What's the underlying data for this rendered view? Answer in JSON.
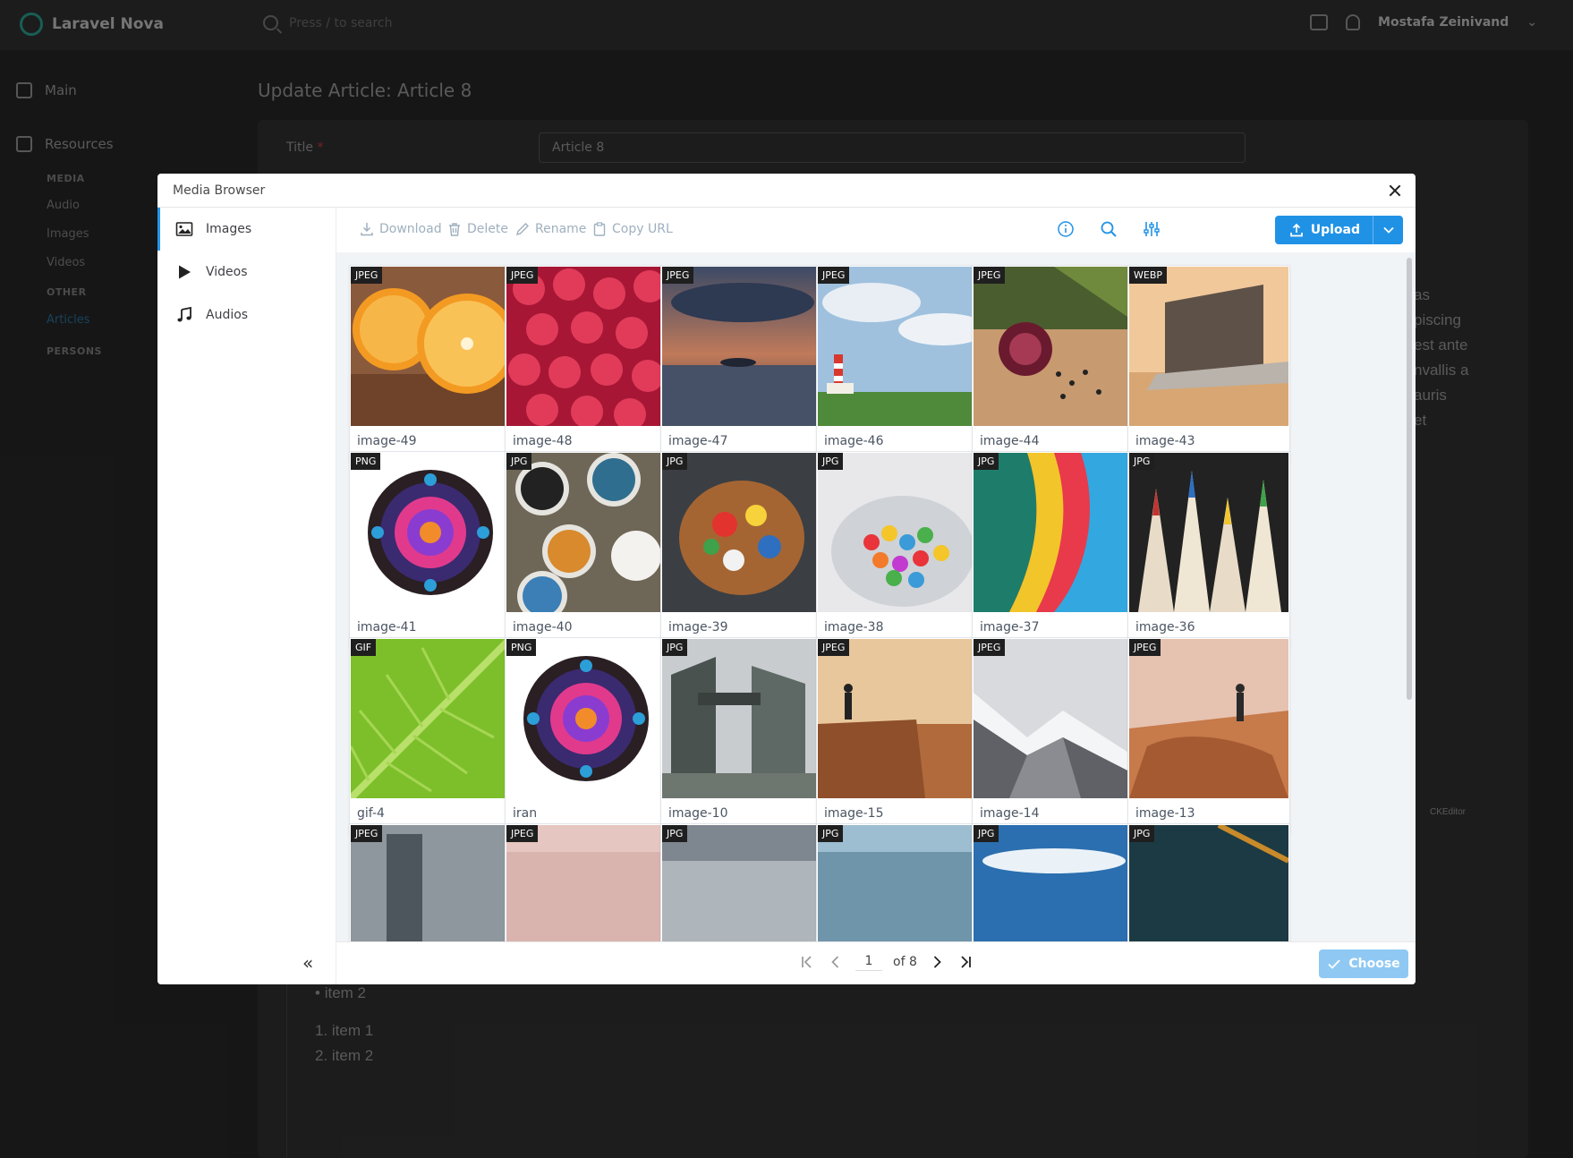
{
  "app": {
    "brand": "Laravel Nova",
    "search_placeholder": "Press / to search",
    "user_name": "Mostafa Zeinivand",
    "page_title": "Update Article: Article 8",
    "title_label": "Title",
    "title_required": "*",
    "title_value": "Article 8"
  },
  "sidebar": {
    "main": "Main",
    "resources": "Resources",
    "media_caption": "MEDIA",
    "audio": "Audio",
    "images": "Images",
    "videos": "Videos",
    "other_caption": "OTHER",
    "articles": "Articles",
    "persons_caption": "PERSONS"
  },
  "editor_bg": {
    "line1": "as",
    "line2": "piscing",
    "line3": "est ante",
    "line4": "nvallis a",
    "line5": "auris",
    "line6": "et",
    "bullet": "item 2",
    "ol1": "1. item 1",
    "ol2": "2. item 2",
    "ckeditor": "CKEditor"
  },
  "modal": {
    "title": "Media Browser",
    "nav": [
      "Images",
      "Videos",
      "Audios"
    ],
    "toolbar": {
      "download": "Download",
      "delete": "Delete",
      "rename": "Rename",
      "copy_url": "Copy URL",
      "upload": "Upload"
    },
    "pager": {
      "page": "1",
      "of": "of 8"
    },
    "choose": "Choose",
    "colors": {
      "accent": "#2092e6",
      "choose_disabled": "#8fc9f3"
    }
  },
  "media": [
    {
      "badge": "JPEG",
      "name": "image-49"
    },
    {
      "badge": "JPEG",
      "name": "image-48"
    },
    {
      "badge": "JPEG",
      "name": "image-47"
    },
    {
      "badge": "JPEG",
      "name": "image-46"
    },
    {
      "badge": "JPEG",
      "name": "image-44"
    },
    {
      "badge": "WEBP",
      "name": "image-43"
    },
    {
      "badge": "PNG",
      "name": "image-41"
    },
    {
      "badge": "JPG",
      "name": "image-40"
    },
    {
      "badge": "JPG",
      "name": "image-39"
    },
    {
      "badge": "JPG",
      "name": "image-38"
    },
    {
      "badge": "JPG",
      "name": "image-37"
    },
    {
      "badge": "JPG",
      "name": "image-36"
    },
    {
      "badge": "GIF",
      "name": "gif-4"
    },
    {
      "badge": "PNG",
      "name": "iran"
    },
    {
      "badge": "JPG",
      "name": "image-10"
    },
    {
      "badge": "JPEG",
      "name": "image-15"
    },
    {
      "badge": "JPEG",
      "name": "image-14"
    },
    {
      "badge": "JPEG",
      "name": "image-13"
    },
    {
      "badge": "JPEG",
      "name": ""
    },
    {
      "badge": "JPEG",
      "name": ""
    },
    {
      "badge": "JPG",
      "name": ""
    },
    {
      "badge": "JPG",
      "name": ""
    },
    {
      "badge": "JPG",
      "name": ""
    },
    {
      "badge": "JPG",
      "name": ""
    }
  ]
}
